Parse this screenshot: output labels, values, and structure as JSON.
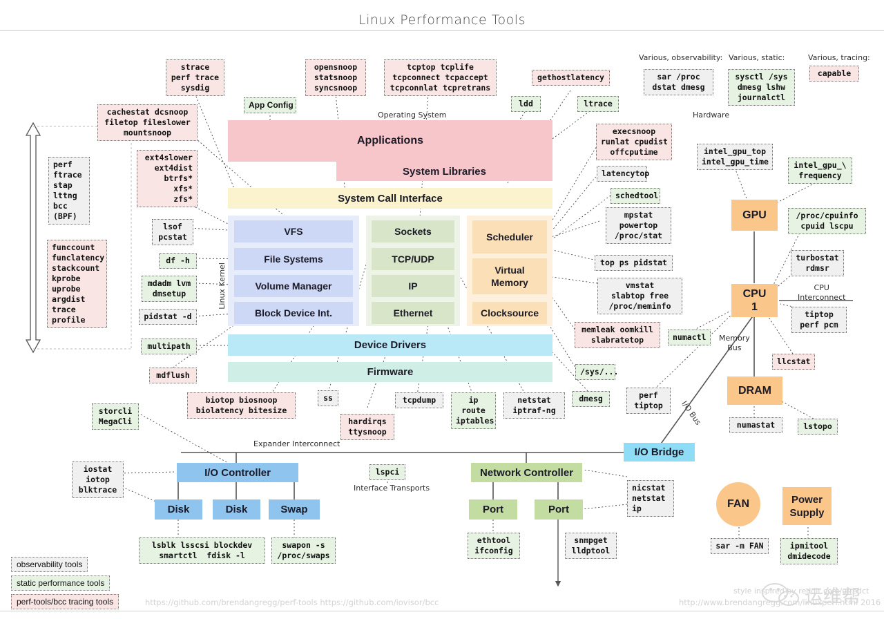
{
  "page": {
    "title": "Linux Performance Tools",
    "footer_left": "https://github.com/brendangregg/perf-tools https://github.com/iovisor/bcc",
    "footer_right": "http://www.brendangregg.com/linuxperf.html 2016",
    "style_credit": "style inspired by reddit.com/u/redct",
    "watermark_cn": "运维帮"
  },
  "legend": {
    "items": [
      {
        "label": "observability tools",
        "kind": "obs"
      },
      {
        "label": "static performance tools",
        "kind": "stat"
      },
      {
        "label": "perf-tools/bcc tracing tools",
        "kind": "trace"
      }
    ]
  },
  "section_labels": {
    "operating_system": "Operating System",
    "hardware": "Hardware",
    "linux_kernel": "Linux Kernel",
    "cpu_interconnect": "CPU\nInterconnect",
    "memory_bus": "Memory\nBus",
    "io_bus": "I/O Bus",
    "expander_interconnect": "Expander Interconnect",
    "interface_transports": "Interface Transports",
    "various_observability": "Various, observability:",
    "various_static": "Various, static:",
    "various_tracing": "Various, tracing:"
  },
  "blocks": {
    "applications": "Applications",
    "system_libraries": "System Libraries",
    "system_call_interface": "System Call Interface",
    "vfs": "VFS",
    "file_systems": "File Systems",
    "volume_manager": "Volume Manager",
    "block_device_int": "Block Device Int.",
    "sockets": "Sockets",
    "tcp_udp": "TCP/UDP",
    "ip": "IP",
    "ethernet": "Ethernet",
    "scheduler": "Scheduler",
    "virtual_memory": "Virtual\nMemory",
    "clocksource": "Clocksource",
    "device_drivers": "Device Drivers",
    "firmware": "Firmware",
    "io_bridge": "I/O Bridge",
    "io_controller": "I/O Controller",
    "disk_1": "Disk",
    "disk_2": "Disk",
    "swap": "Swap",
    "network_controller": "Network Controller",
    "port_1": "Port",
    "port_2": "Port",
    "gpu": "GPU",
    "cpu": "CPU\n1",
    "dram": "DRAM",
    "fan": "FAN",
    "power_supply": "Power\nSupply"
  },
  "tools": {
    "strace": "strace\nperf trace\nsysdig",
    "opensnoop": "opensnoop\nstatsnoop\nsyncsnoop",
    "tcptop": "tcptop tcplife\ntcpconnect tcpaccept\ntcpconnlat tcpretrans",
    "gethostlatency": "gethostlatency",
    "sar_proc": "sar /proc\ndstat dmesg",
    "sysctl": "sysctl /sys\ndmesg lshw\njournalctl",
    "capable": "capable",
    "app_config": "App Config",
    "cachestat": "cachestat dcsnoop\nfiletop fileslower\nmountsnoop",
    "ldd": "ldd",
    "ltrace": "ltrace",
    "execsnoop": "execsnoop\nrunlat cpudist\noffcputime",
    "intel_gpu_top": "intel_gpu_top\nintel_gpu_time",
    "intel_gpu_frequency": "intel_gpu_\\\nfrequency",
    "perf_ftrace": "perf\nftrace\nstap\nlttng\nbcc\n(BPF)",
    "ext4slower": "ext4slower\next4dist\nbtrfs*\nxfs*\nzfs*",
    "latencytop": "latencytop",
    "schedtool": "schedtool",
    "proc_cpuinfo": "/proc/cpuinfo\ncpuid lscpu",
    "lsof": "lsof\npcstat",
    "mpstat": "mpstat\npowertop\n/proc/stat",
    "turbostat": "turbostat\nrdmsr",
    "funccount": "funccount\nfunclatency\nstackcount\nkprobe\nuprobe\nargdist\ntrace\nprofile",
    "df_h": "df -h",
    "top_ps": "top ps pidstat",
    "mdadm": "mdadm lvm\ndmsetup",
    "vmstat": "vmstat\nslabtop free\n/proc/meminfo",
    "tiptop_perf_pcm": "tiptop\nperf pcm",
    "pidstat_d": "pidstat -d",
    "memleak": "memleak oomkill\nslabratetop",
    "numactl": "numactl",
    "llcstat": "llcstat",
    "multipath": "multipath",
    "sys_dots": "/sys/...",
    "mdflush": "mdflush",
    "biotop": "biotop biosnoop\nbiolatency bitesize",
    "ss": "ss",
    "tcpdump": "tcpdump",
    "ip_route": "ip\nroute\niptables",
    "netstat_iptraf": "netstat\niptraf-ng",
    "dmesg": "dmesg",
    "perf_tiptop": "perf\ntiptop",
    "numastat": "numastat",
    "lstopo": "lstopo",
    "storcli": "storcli\nMegaCli",
    "hardirqs": "hardirqs\nttysnoop",
    "iostat": "iostat\niotop\nblktrace",
    "lspci": "lspci",
    "nicstat": "nicstat\nnetstat\nip",
    "lsblk": "lsblk lsscsi blockdev\nsmartctl  fdisk -l",
    "swapon": "swapon -s\n/proc/swaps",
    "ethtool": "ethtool\nifconfig",
    "snmpget": "snmpget\nlldptool",
    "sar_fan": "sar -m FAN",
    "ipmitool": "ipmitool\ndmidecode"
  },
  "colors": {
    "observability": "#f0f0f0",
    "static": "#e6f3e2",
    "tracing": "#fae5e5",
    "applications": "#f7c6cb",
    "syscall": "#fbf3cd",
    "filesystem": "#ccd8f5",
    "network": "#d8e5c8",
    "cpu": "#fbdfb6",
    "drivers": "#b9e8f7",
    "firmware": "#cfeee6",
    "hw_blue": "#7cb9e8",
    "hw_green": "#c3dca2",
    "hw_orange": "#fbc68a"
  }
}
